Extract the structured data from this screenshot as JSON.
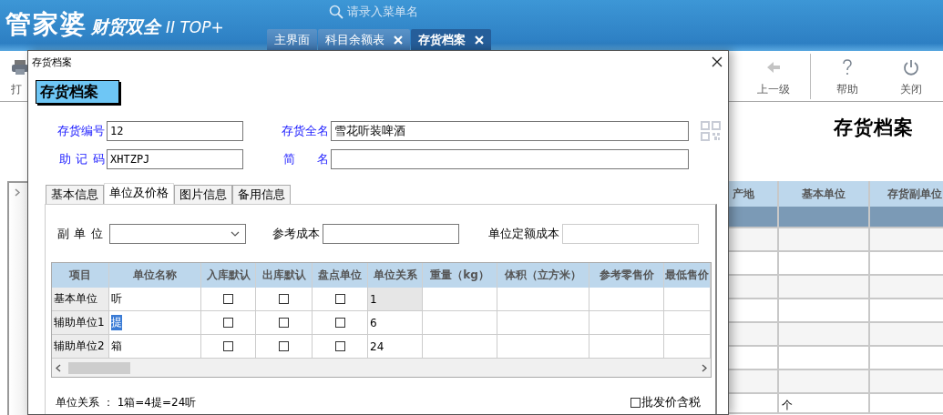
{
  "app": {
    "logo": "管家婆",
    "logo_sub": "财贸双全",
    "logo_edition": "II TOP+",
    "search": {
      "placeholder": "请录入菜单名"
    },
    "tabs": [
      {
        "label": "主界面",
        "closable": false,
        "selected": false
      },
      {
        "label": "科目余额表",
        "closable": true,
        "selected": false
      },
      {
        "label": "存货档案",
        "closable": true,
        "selected": true
      }
    ]
  },
  "toolbar": [
    {
      "label": "打",
      "kind": "print"
    },
    {
      "label": "上一级",
      "kind": "back"
    },
    {
      "label": "帮助",
      "kind": "help"
    },
    {
      "label": "关闭",
      "kind": "power"
    }
  ],
  "page_title": "存货档案",
  "background_table": {
    "columns": [
      "产地",
      "基本单位",
      "存货副单位"
    ],
    "rows": [
      {
        "selected": true
      },
      {
        "selected": false
      },
      {
        "selected": false
      },
      {
        "selected": false
      },
      {
        "selected": false
      },
      {
        "selected": false
      },
      {
        "selected": false
      },
      {
        "selected": false
      },
      {
        "selected": false,
        "base_unit": "个"
      }
    ]
  },
  "dialog": {
    "title": "存货档案",
    "heading": "存货档案",
    "fields": [
      {
        "label": "存货编号",
        "value": "12"
      },
      {
        "label": "存货全名",
        "value": "雪花听装啤酒"
      },
      {
        "label": "助 记 码",
        "value": "XHTZPJ"
      },
      {
        "label": "简 名"
      }
    ],
    "tabs": [
      {
        "label": "基本信息",
        "selected": false
      },
      {
        "label": "单位及价格",
        "selected": true
      },
      {
        "label": "图片信息",
        "selected": false
      },
      {
        "label": "备用信息",
        "selected": false
      }
    ],
    "unit_fields": [
      {
        "label": "副 单 位",
        "kind": "select"
      },
      {
        "label": "参考成本",
        "kind": "text"
      },
      {
        "label": "单位定额成本",
        "kind": "text"
      }
    ],
    "grid": {
      "columns": [
        "项目",
        "单位名称",
        "入库默认",
        "出库默认",
        "盘点单位",
        "单位关系",
        "重量（kg）",
        "体积（立方米）",
        "参考零售价",
        "最低售价"
      ],
      "rows": [
        {
          "item": "基本单位",
          "unit_name": "听",
          "name_highlighted": false,
          "in_default": false,
          "out_default": false,
          "count_unit": false,
          "relation": "1",
          "relation_readonly": true
        },
        {
          "item": "辅助单位1",
          "unit_name": "提",
          "name_highlighted": true,
          "in_default": false,
          "out_default": false,
          "count_unit": false,
          "relation": "6",
          "relation_readonly": false
        },
        {
          "item": "辅助单位2",
          "unit_name": "箱",
          "name_highlighted": false,
          "in_default": false,
          "out_default": false,
          "count_unit": false,
          "relation": "24",
          "relation_readonly": false
        }
      ]
    },
    "summary": "单位关系 ： 1箱=4提=24听",
    "wholesale_tax": {
      "label": "批发价含税",
      "checked": false
    }
  }
}
